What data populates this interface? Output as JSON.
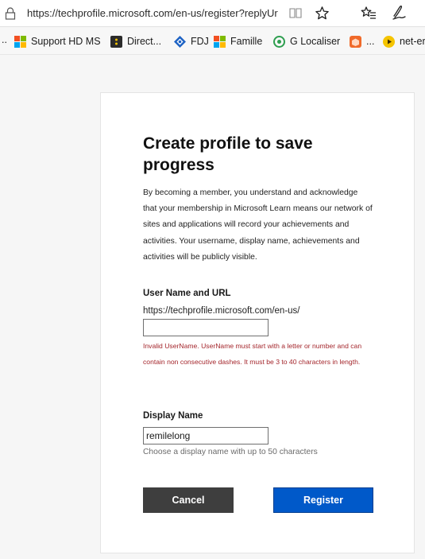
{
  "browser": {
    "url": "https://techprofile.microsoft.com/en-us/register?replyUr",
    "bookmarks": [
      {
        "label": "Support HD MS",
        "icon": "windows-logo-icon"
      },
      {
        "label": "Direct...",
        "icon": "dark-app-icon"
      },
      {
        "label": "FDJ",
        "icon": "diamond-logo-icon"
      },
      {
        "label": "Famille",
        "icon": "windows-logo-icon"
      },
      {
        "label": "G Localiser",
        "icon": "green-circle-icon"
      },
      {
        "label": "...",
        "icon": "orange-box-icon"
      },
      {
        "label": "net-er",
        "icon": "yellow-play-icon"
      }
    ],
    "overflow_left": ".."
  },
  "page": {
    "title": "Create profile to save progress",
    "intro": "By becoming a member, you understand and acknowledge that your membership in Microsoft Learn means our network of sites and applications will record your achievements and activities. Your username, display name, achievements and activities will be publicly visible.",
    "username": {
      "label": "User Name and URL",
      "prefix": "https://techprofile.microsoft.com/en-us/",
      "value": "",
      "error": "Invalid UserName. UserName must start with a letter or number and can contain non consecutive dashes. It must be 3 to 40 characters in length."
    },
    "display_name": {
      "label": "Display Name",
      "value": "remilelong",
      "hint": "Choose a display name with up to 50 characters"
    },
    "buttons": {
      "cancel": "Cancel",
      "register": "Register"
    }
  },
  "colors": {
    "error": "#a4262c",
    "primary": "#0059c9",
    "secondary": "#3e3e3e"
  }
}
